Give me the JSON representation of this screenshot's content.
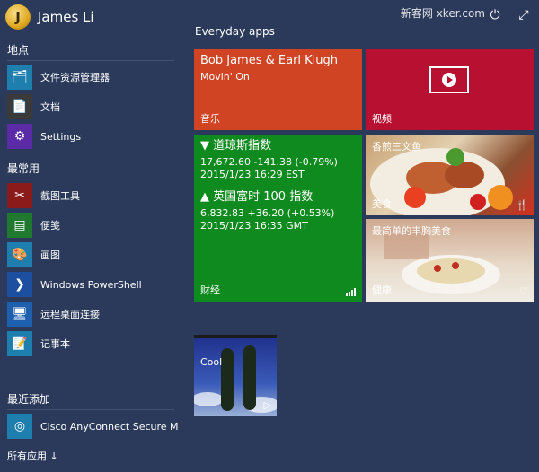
{
  "user": {
    "name": "James Li",
    "avatar_glyph": "J"
  },
  "watermark": "新客网 xker.com",
  "sections": {
    "places": "地点",
    "most_used": "最常用",
    "recently_added": "最近添加",
    "all_apps": "所有应用 ↓"
  },
  "places": [
    {
      "label": "文件资源管理器",
      "icon": "file-explorer-icon",
      "color": "#1e7fae"
    },
    {
      "label": "文档",
      "icon": "documents-icon",
      "color": "#3a3a3a"
    },
    {
      "label": "Settings",
      "icon": "gear-icon",
      "color": "#5b2aa6"
    }
  ],
  "most_used": [
    {
      "label": "截图工具",
      "icon": "snipping-tool-icon",
      "color": "#8b1a1a"
    },
    {
      "label": "便笺",
      "icon": "sticky-notes-icon",
      "color": "#1f7a2f"
    },
    {
      "label": "画图",
      "icon": "paint-icon",
      "color": "#1e7fae"
    },
    {
      "label": "Windows PowerShell",
      "icon": "powershell-icon",
      "color": "#1c4fa0"
    },
    {
      "label": "远程桌面连接",
      "icon": "remote-desktop-icon",
      "color": "#1e5fae"
    },
    {
      "label": "记事本",
      "icon": "notepad-icon",
      "color": "#1e7fae"
    }
  ],
  "recently_added": [
    {
      "label": "Cisco AnyConnect Secure Mo...",
      "icon": "cisco-icon",
      "color": "#1e7fae"
    }
  ],
  "group_title": "Everyday apps",
  "tiles": {
    "music": {
      "artist": "Bob James & Earl Klugh",
      "album": "Movin' On",
      "label": "音乐",
      "color": "#d04424"
    },
    "video": {
      "label": "视频",
      "color": "#b81030"
    },
    "finance": {
      "label": "财经",
      "index1": {
        "name": "▼ 道琼斯指数",
        "value": "17,672.60 -141.38 (-0.79%)",
        "time": "2015/1/23 16:29 EST"
      },
      "index2": {
        "name": "▲ 英国富时 100 指数",
        "value": "6,832.83 +36.20 (+0.53%)",
        "time": "2015/1/23 16:35 GMT"
      }
    },
    "food": {
      "headline": "香煎三文鱼",
      "label": "美食"
    },
    "health": {
      "headline": "最简单的丰胸美食",
      "label": "健康"
    },
    "cool": {
      "label": "Cool"
    }
  }
}
